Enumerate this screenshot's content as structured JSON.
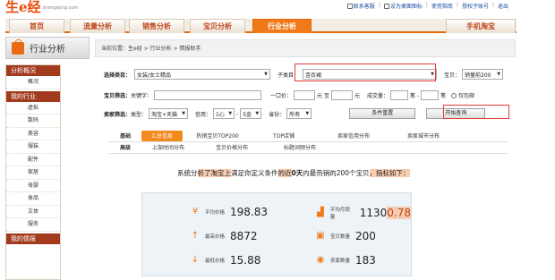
{
  "header": {
    "logo_text": "生e经",
    "logo_domain": "shengejing.com",
    "links": [
      "联系客服",
      "设为桌面图标",
      "使用指南",
      "授权子账号",
      "退出"
    ]
  },
  "nav": {
    "tabs": [
      "首页",
      "流量分析",
      "销售分析",
      "宝贝分析",
      "行业分析",
      "手机淘宝"
    ],
    "active": "行业分析"
  },
  "sidebar": {
    "header_title": "行业分析",
    "sections": [
      {
        "title": "分析概况",
        "items": [
          "概况"
        ]
      },
      {
        "title": "我的行业",
        "items": [
          "虚拟",
          "数码",
          "美容",
          "服装",
          "配件",
          "家居",
          "母婴",
          "食品",
          "文体",
          "服务"
        ]
      },
      {
        "title": "我的情报",
        "items": []
      }
    ]
  },
  "breadcrumb": "当前位置：生e经 > 行业分析 > 情报助手",
  "filters": {
    "category_label": "选择类目：",
    "category_value": "女装/女士精品",
    "subcategory_label": "子类目：",
    "subcategory_value": "连衣裙",
    "baby_label": "宝贝：",
    "baby_value": "销量前200",
    "baby_filter_label": "宝贝筛选：",
    "keyword_label": "关键字：",
    "price_label": "一口价：",
    "yuan_to": "元 至",
    "yuan": "元",
    "deal_label": "成交量：",
    "to_label": "笔 -",
    "count_unit": "笔",
    "only_label": "仅包邮",
    "seller_filter_label": "卖家筛选：",
    "type_label": "类型：",
    "type_value": "淘宝+天猫",
    "credit_label": "信用：",
    "credit_from": "1心",
    "credit_to": "5金",
    "province_label": "省份：",
    "province_value": "所有",
    "reset_button": "条件重置",
    "query_button": "开始查询"
  },
  "result_tabs": {
    "row1": [
      "基础",
      "汇总信息",
      "热销宝贝TOP200",
      "TOP店铺",
      "卖家信用分布",
      "卖家城市分布"
    ],
    "row2": [
      "高级",
      "上架时间分布",
      "宝贝价格分布",
      "标题词频分布"
    ],
    "active": "汇总信息"
  },
  "notice": {
    "prefix": "系统分",
    "hl1": "析了淘宝上",
    "mid": "满足你定义条件",
    "hl2": "的近",
    "bold": "0天",
    "rest": "内最热销的200个宝贝",
    "hl3": "，指标如下：",
    "hl4": " "
  },
  "stats": {
    "avg_price_label": "平均价格",
    "avg_price": "198.83",
    "avg_sales_label": "平均月销量",
    "avg_sales_a": "1130",
    "avg_sales_b": "0.78",
    "max_price_label": "最高价格",
    "max_price": "8872",
    "item_count_label": "宝贝数量",
    "item_count": "200",
    "min_price_label": "最低价格",
    "min_price": "15.88",
    "seller_count_label": "卖家数量",
    "seller_count": "183"
  },
  "colors": {
    "accent": "#f07a1a",
    "sidebar_section": "#a23b1e",
    "highlight": "#f8ccb0"
  }
}
